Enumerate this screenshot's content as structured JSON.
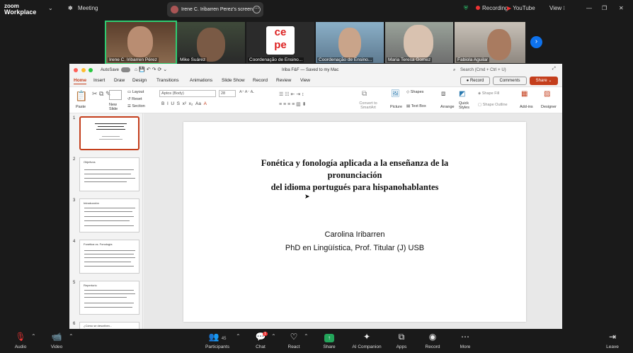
{
  "topbar": {
    "brand_line1": "zoom",
    "brand_line2": "Workplace",
    "meeting_label": "Meeting",
    "share_tab_label": "Irene C. Iribarren Perez's screen",
    "recording_label": "Recording",
    "youtube_label": "YouTube",
    "view_label": "View"
  },
  "participants_strip": [
    {
      "name": "Irene C. Iribarren Pérez",
      "active": true
    },
    {
      "name": "Mike Suárez"
    },
    {
      "name": "Coordenação de Ensino..."
    },
    {
      "name": "Coordenação de Ensino..."
    },
    {
      "name": "Maria Teresa Gomez"
    },
    {
      "name": "Fabiola Aguilar"
    }
  ],
  "ppt": {
    "autosave": "AutoSave",
    "filename": "Iriba F&F — Saved to my Mac",
    "search_placeholder": "Search (Cmd + Ctrl + U)",
    "tabs": [
      "Home",
      "Insert",
      "Draw",
      "Design",
      "Transitions",
      "Animations",
      "Slide Show",
      "Record",
      "Review",
      "View"
    ],
    "record_btn": "Record",
    "comments_btn": "Comments",
    "share_btn": "Share",
    "ribbon": {
      "paste": "Paste",
      "new_slide": "New Slide",
      "layout": "Layout",
      "reset": "Reset",
      "section": "Section",
      "font": "Aptos (Body)",
      "font_size": "28",
      "convert_smartart": "Convert to SmartArt",
      "picture": "Picture",
      "shapes": "Shapes",
      "text_box": "Text Box",
      "arrange": "Arrange",
      "quick_styles": "Quick Styles",
      "shape_fill": "Shape Fill",
      "shape_outline": "Shape Outline",
      "addins": "Add-ins",
      "designer": "Designer"
    },
    "slide_thumbs": [
      {
        "num": "1",
        "title": "Fonética y fonología aplicada a la enseñanza de la pronunciación"
      },
      {
        "num": "2",
        "title": "Objetivos"
      },
      {
        "num": "3",
        "title": "Introducción"
      },
      {
        "num": "4",
        "title": "Fonética vs. Fonología"
      },
      {
        "num": "5",
        "title": "Repertorio"
      },
      {
        "num": "6",
        "title": "¿Cómo se describen..."
      }
    ],
    "slide": {
      "title_line1": "Fonética y fonología aplicada a la enseñanza de la",
      "title_line2": "pronunciación",
      "title_line3": "del idioma portugués para hispanohablantes",
      "author": "Carolina Iribarren",
      "affiliation": "PhD en Lingüística, Prof. Titular (J) USB"
    }
  },
  "bottombar": {
    "audio": "Audio",
    "video": "Video",
    "participants": "Participants",
    "participants_count": "45",
    "chat": "Chat",
    "chat_badge": "1",
    "react": "React",
    "share": "Share",
    "ai_companion": "AI Companion",
    "apps": "Apps",
    "record": "Record",
    "more": "More",
    "leave": "Leave"
  }
}
